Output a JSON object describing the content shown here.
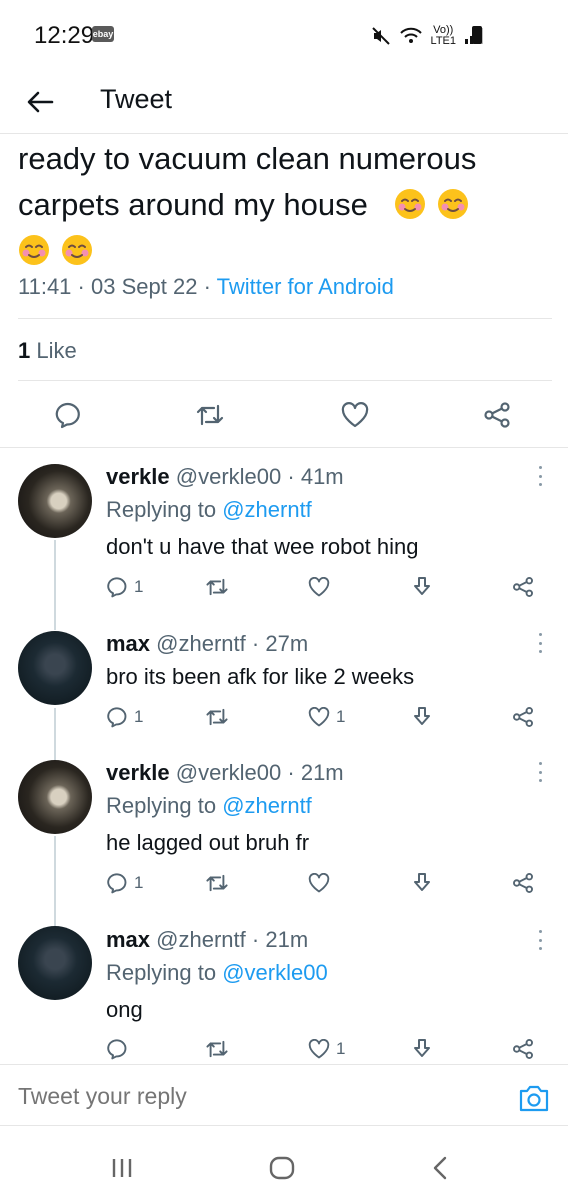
{
  "status_bar": {
    "time": "12:29",
    "badge": "ebay",
    "network_top": "Vo))",
    "network_bottom": "LTE1"
  },
  "header": {
    "title": "Tweet"
  },
  "main_tweet": {
    "text": "ready to vacuum clean numerous carpets around my house",
    "time": "11:41",
    "date": "03 Sept 22",
    "source": "Twitter for Android",
    "separator": "·",
    "likes_count": "1",
    "likes_label": "Like"
  },
  "replies": [
    {
      "name": "verkle",
      "handle": "@verkle00",
      "age": "41m",
      "replying_prefix": "Replying to",
      "replying_to": "@zherntf",
      "text": "don't u have that wee robot hing",
      "reply_count": "1",
      "like_count": ""
    },
    {
      "name": "max",
      "handle": "@zherntf",
      "age": "27m",
      "text": "bro its been afk for like 2 weeks",
      "reply_count": "1",
      "like_count": "1"
    },
    {
      "name": "verkle",
      "handle": "@verkle00",
      "age": "21m",
      "replying_prefix": "Replying to",
      "replying_to": "@zherntf",
      "text": "he lagged out bruh fr",
      "reply_count": "1",
      "like_count": ""
    },
    {
      "name": "max",
      "handle": "@zherntf",
      "age": "21m",
      "replying_prefix": "Replying to",
      "replying_to": "@verkle00",
      "text": "ong",
      "reply_count": "",
      "like_count": "1"
    }
  ],
  "composer": {
    "placeholder": "Tweet your reply"
  },
  "colors": {
    "accent": "#1d9bf0",
    "text": "#0f1419",
    "muted": "#536471",
    "divider": "#e6e6e6"
  },
  "icons": [
    "back-arrow-icon",
    "reply-icon",
    "retweet-icon",
    "like-icon",
    "share-icon",
    "download-icon",
    "camera-icon",
    "more-icon",
    "smiling-face-emoji"
  ]
}
